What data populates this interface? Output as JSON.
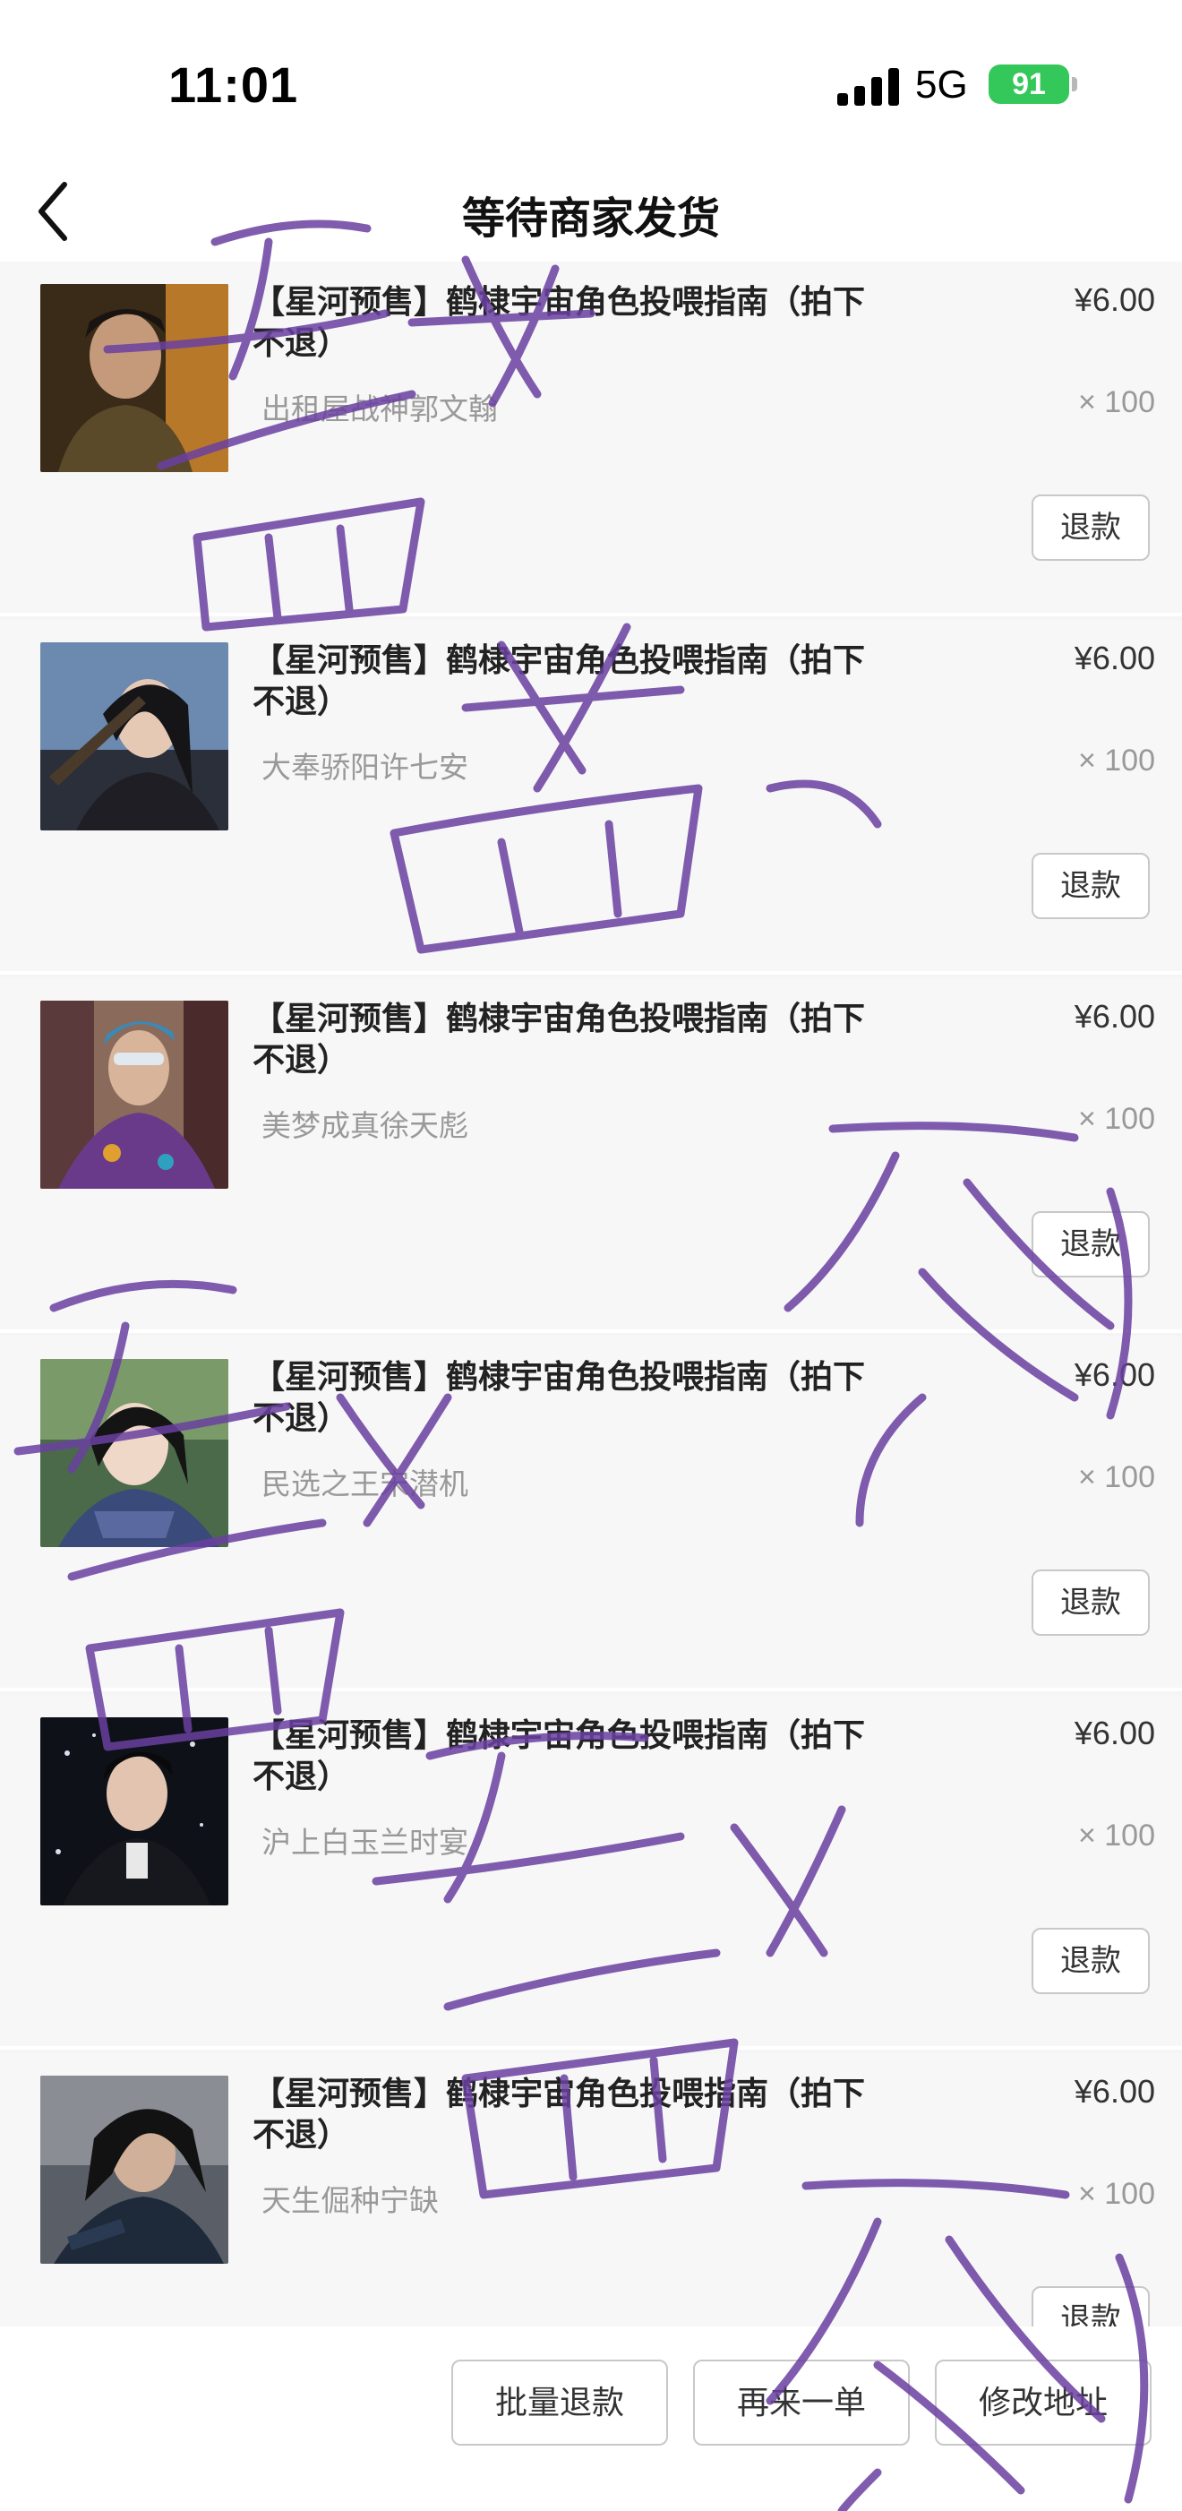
{
  "status_bar": {
    "time": "11:01",
    "network": "5G",
    "battery": "91"
  },
  "nav": {
    "title": "等待商家发货",
    "back_icon": "chevron-left-icon"
  },
  "items": [
    {
      "title": "【星河预售】鹤棣宇宙角色投喂指南（拍下不退）",
      "variant": "出租屋战神郭文翰",
      "price": "¥6.00",
      "quantity": "× 100",
      "refund_label": "退款"
    },
    {
      "title": "【星河预售】鹤棣宇宙角色投喂指南（拍下不退）",
      "variant": "大奉骄阳许七安",
      "price": "¥6.00",
      "quantity": "× 100",
      "refund_label": "退款"
    },
    {
      "title": "【星河预售】鹤棣宇宙角色投喂指南（拍下不退）",
      "variant": "美梦成真徐天彪",
      "price": "¥6.00",
      "quantity": "× 100",
      "refund_label": "退款"
    },
    {
      "title": "【星河预售】鹤棣宇宙角色投喂指南（拍下不退）",
      "variant": "民选之王宋潜机",
      "price": "¥6.00",
      "quantity": "× 100",
      "refund_label": "退款"
    },
    {
      "title": "【星河预售】鹤棣宇宙角色投喂指南（拍下不退）",
      "variant": "沪上白玉兰时宴",
      "price": "¥6.00",
      "quantity": "× 100",
      "refund_label": "退款"
    },
    {
      "title": "【星河预售】鹤棣宇宙角色投喂指南（拍下不退）",
      "variant": "天生倔种宁缺",
      "price": "¥6.00",
      "quantity": "× 100",
      "refund_label": "退款"
    }
  ],
  "bottom_bar": {
    "batch_refund": "批量退款",
    "reorder": "再来一单",
    "edit_address": "修改地址"
  },
  "colors": {
    "watermark": "#6a3fa0",
    "battery": "#34c759"
  }
}
